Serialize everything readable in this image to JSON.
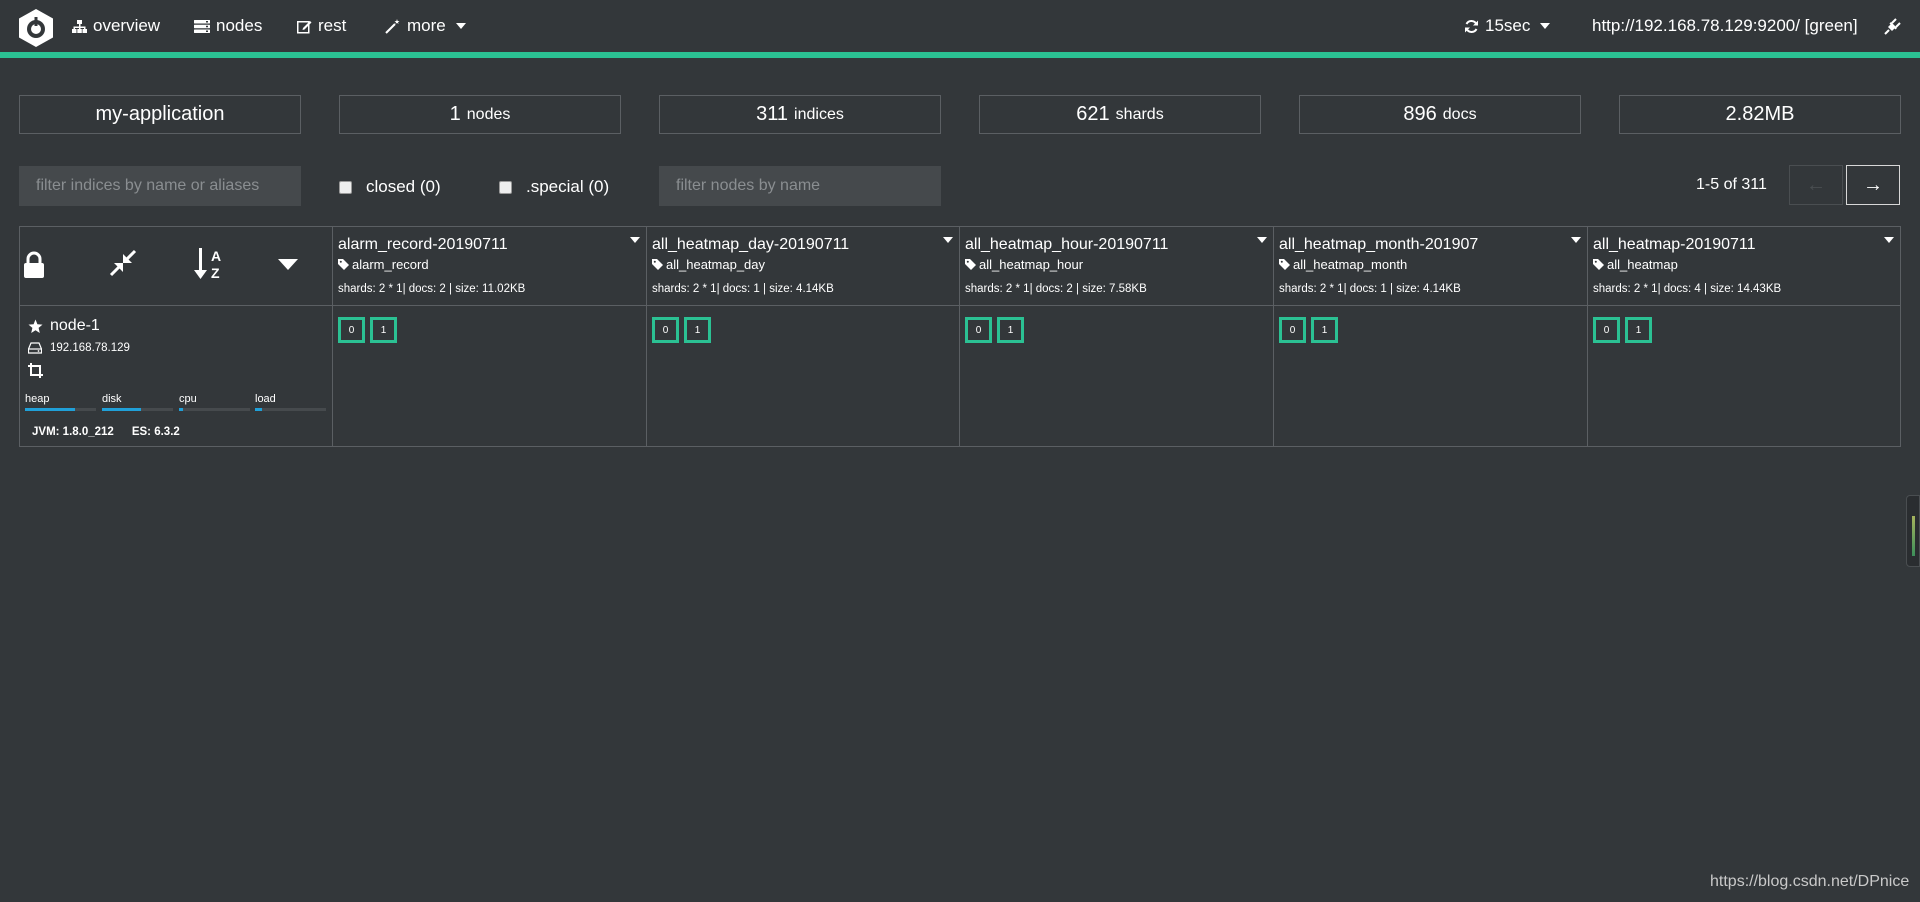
{
  "nav": {
    "items": [
      {
        "label": "overview",
        "icon": "sitemap-icon"
      },
      {
        "label": "nodes",
        "icon": "server-icon"
      },
      {
        "label": "rest",
        "icon": "edit-icon"
      },
      {
        "label": "more",
        "icon": "magic-wand-icon"
      }
    ],
    "refresh_label": "15sec",
    "cluster_url": "http://192.168.78.129:9200/ [green]",
    "accent_color": "#2bc193"
  },
  "stats": {
    "cluster_name": "my-application",
    "nodes": {
      "value": "1",
      "unit": "nodes"
    },
    "indices": {
      "value": "311",
      "unit": "indices"
    },
    "shards": {
      "value": "621",
      "unit": "shards"
    },
    "docs": {
      "value": "896",
      "unit": "docs"
    },
    "size": "2.82MB"
  },
  "filters": {
    "indices_placeholder": "filter indices by name or aliases",
    "closed_label": "closed (0)",
    "special_label": ".special (0)",
    "nodes_placeholder": "filter nodes by name"
  },
  "pager": {
    "text": "1-5 of 311",
    "prev": "←",
    "next": "→"
  },
  "indices": [
    {
      "name": "alarm_record-20190711",
      "alias": "alarm_record",
      "meta": "shards: 2 * 1| docs: 2 | size: 11.02KB",
      "shards": [
        "0",
        "1"
      ]
    },
    {
      "name": "all_heatmap_day-20190711",
      "alias": "all_heatmap_day",
      "meta": "shards: 2 * 1| docs: 1 | size: 4.14KB",
      "shards": [
        "0",
        "1"
      ]
    },
    {
      "name": "all_heatmap_hour-20190711",
      "alias": "all_heatmap_hour",
      "meta": "shards: 2 * 1| docs: 2 | size: 7.58KB",
      "shards": [
        "0",
        "1"
      ]
    },
    {
      "name": "all_heatmap_month-201907",
      "alias": "all_heatmap_month",
      "meta": "shards: 2 * 1| docs: 1 | size: 4.14KB",
      "shards": [
        "0",
        "1"
      ]
    },
    {
      "name": "all_heatmap-20190711",
      "alias": "all_heatmap",
      "meta": "shards: 2 * 1| docs: 4 | size: 14.43KB",
      "shards": [
        "0",
        "1"
      ]
    }
  ],
  "node": {
    "name": "node-1",
    "ip": "192.168.78.129",
    "metrics": [
      {
        "label": "heap",
        "level": 0.7
      },
      {
        "label": "disk",
        "level": 0.55
      },
      {
        "label": "cpu",
        "level": 0.06
      },
      {
        "label": "load",
        "level": 0.1
      }
    ],
    "jvm": "JVM: 1.8.0_212",
    "es": "ES: 6.3.2",
    "metric_color": "#20a0d8"
  },
  "watermark": "https://blog.csdn.net/DPnice"
}
